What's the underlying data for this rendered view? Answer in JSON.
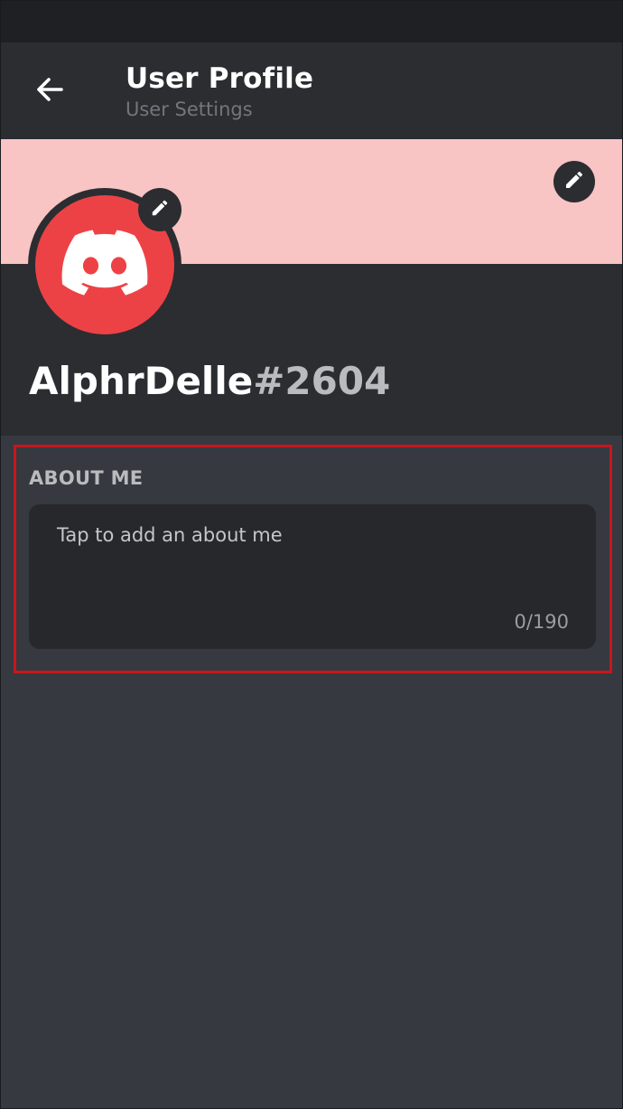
{
  "header": {
    "title": "User Profile",
    "subtitle": "User Settings",
    "back_icon": "arrow-left-icon"
  },
  "banner": {
    "color": "#f8c4c4",
    "edit_icon": "pencil-icon"
  },
  "avatar": {
    "color": "#ed4245",
    "icon": "discord-logo-icon",
    "edit_icon": "pencil-icon"
  },
  "user": {
    "username": "AlphrDelle",
    "discriminator": "#2604"
  },
  "about_me": {
    "heading": "ABOUT ME",
    "placeholder": "Tap to add an about me",
    "counter": "0/190",
    "highlight_color": "#c8161d"
  }
}
